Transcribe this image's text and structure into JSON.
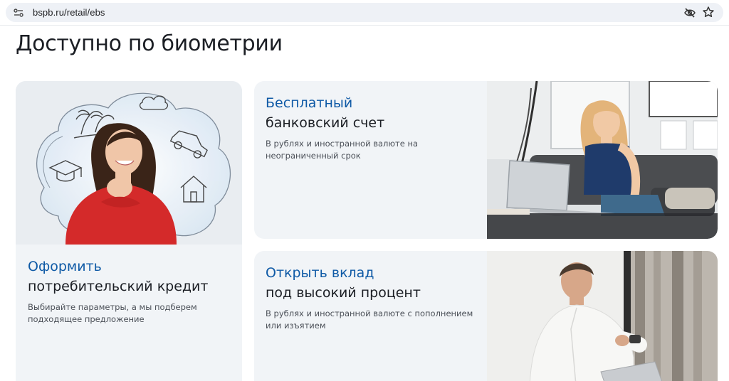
{
  "browser": {
    "url": "bspb.ru/retail/ebs"
  },
  "page": {
    "title": "Доступно по биометрии"
  },
  "cards": [
    {
      "title_accent": "Оформить",
      "title_main": "потребительский кредит",
      "description": "Выбирайте параметры, а мы подберем подходящее предложение"
    },
    {
      "title_accent": "Бесплатный",
      "title_main": "банковский счет",
      "description": "В рублях и иностранной валюте на неограниченный срок"
    },
    {
      "title_accent": "Открыть вклад",
      "title_main": "под высокий процент",
      "description": "В рублях и иностранной валюте с пополнением или изъятием"
    }
  ],
  "colors": {
    "accent": "#0f5aa6",
    "card_bg": "#f1f4f7",
    "credit_sweater": "#d42a2a"
  }
}
